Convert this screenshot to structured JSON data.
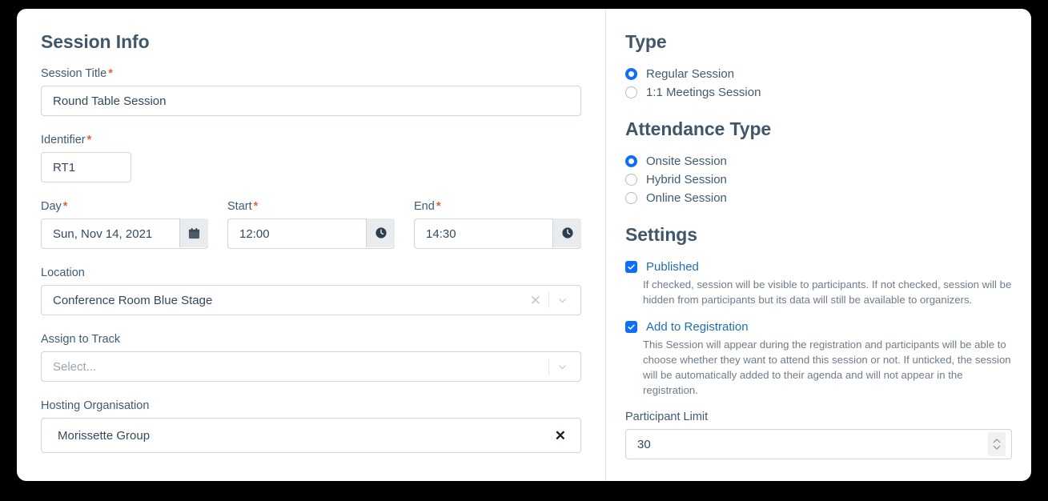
{
  "left": {
    "heading": "Session Info",
    "fields": {
      "session_title": {
        "label": "Session Title",
        "required": true,
        "value": "Round Table Session"
      },
      "identifier": {
        "label": "Identifier",
        "required": true,
        "value": "RT1"
      },
      "day": {
        "label": "Day",
        "required": true,
        "value": "Sun, Nov 14, 2021",
        "icon": "calendar-icon"
      },
      "start": {
        "label": "Start",
        "required": true,
        "value": "12:00",
        "icon": "clock-icon"
      },
      "end": {
        "label": "End",
        "required": true,
        "value": "14:30",
        "icon": "clock-icon"
      },
      "location": {
        "label": "Location",
        "required": false,
        "value": "Conference Room Blue Stage",
        "clear_icon": "close-icon",
        "dropdown_icon": "chevron-down-icon"
      },
      "assign_to_track": {
        "label": "Assign to Track",
        "required": false,
        "value": "",
        "placeholder": "Select...",
        "dropdown_icon": "chevron-down-icon"
      },
      "hosting_organisation": {
        "label": "Hosting Organisation",
        "required": false,
        "value": "Morissette Group",
        "clear_icon": "close-icon"
      }
    }
  },
  "right": {
    "type": {
      "heading": "Type",
      "options": [
        {
          "label": "Regular Session",
          "checked": true
        },
        {
          "label": "1:1 Meetings Session",
          "checked": false
        }
      ]
    },
    "attendance_type": {
      "heading": "Attendance Type",
      "options": [
        {
          "label": "Onsite Session",
          "checked": true
        },
        {
          "label": "Hybrid Session",
          "checked": false
        },
        {
          "label": "Online Session",
          "checked": false
        }
      ]
    },
    "settings": {
      "heading": "Settings",
      "published": {
        "label": "Published",
        "checked": true,
        "help": "If checked, session will be visible to participants. If not checked, session will be hidden from participants but its data will still be available to organizers."
      },
      "add_to_registration": {
        "label": "Add to Registration",
        "checked": true,
        "help": "This Session will appear during the registration and participants will be able to choose whether they want to attend this session or not. If unticked, the session will be automatically added to their agenda and will not appear in the registration."
      },
      "participant_limit": {
        "label": "Participant Limit",
        "value": "30",
        "spinner_icon": "stepper-icon"
      }
    }
  },
  "colors": {
    "accent": "#0d6efd",
    "heading": "#40576b",
    "required_star": "#e8603c",
    "label": "#3f5b74",
    "help": "#6f7c8a",
    "border": "#ced4da"
  }
}
